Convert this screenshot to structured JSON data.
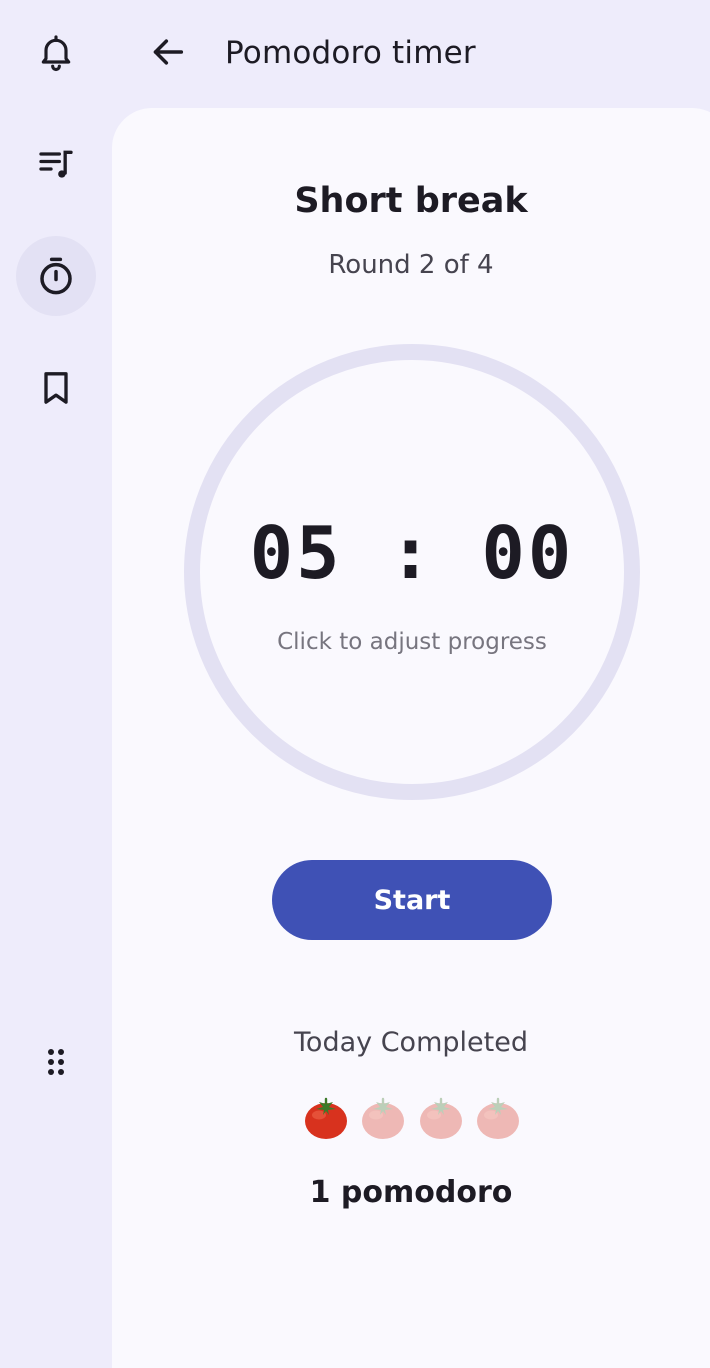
{
  "app": {
    "title": "Pomodoro timer"
  },
  "rail": {
    "items": [
      {
        "icon": "bell-icon",
        "label": "Notifications",
        "active": false
      },
      {
        "icon": "playlist-icon",
        "label": "Playlist",
        "active": false
      },
      {
        "icon": "timer-icon",
        "label": "Timer",
        "active": true
      },
      {
        "icon": "bookmark-icon",
        "label": "Bookmarks",
        "active": false
      }
    ],
    "bottom_icon": "apps-grid-icon"
  },
  "session": {
    "title": "Short break",
    "round": "Round 2 of 4"
  },
  "timer": {
    "display": "05:00",
    "hint": "Click to adjust progress"
  },
  "controls": {
    "start_label": "Start"
  },
  "today": {
    "label": "Today Completed",
    "completed": 1,
    "total": 4,
    "count_text": "1 pomodoro"
  },
  "colors": {
    "background": "#eeecfb",
    "card": "#faf9fe",
    "accent": "#3f51b5",
    "dial_track": "#e3e1f3",
    "active_nav": "#e3e1f4"
  }
}
